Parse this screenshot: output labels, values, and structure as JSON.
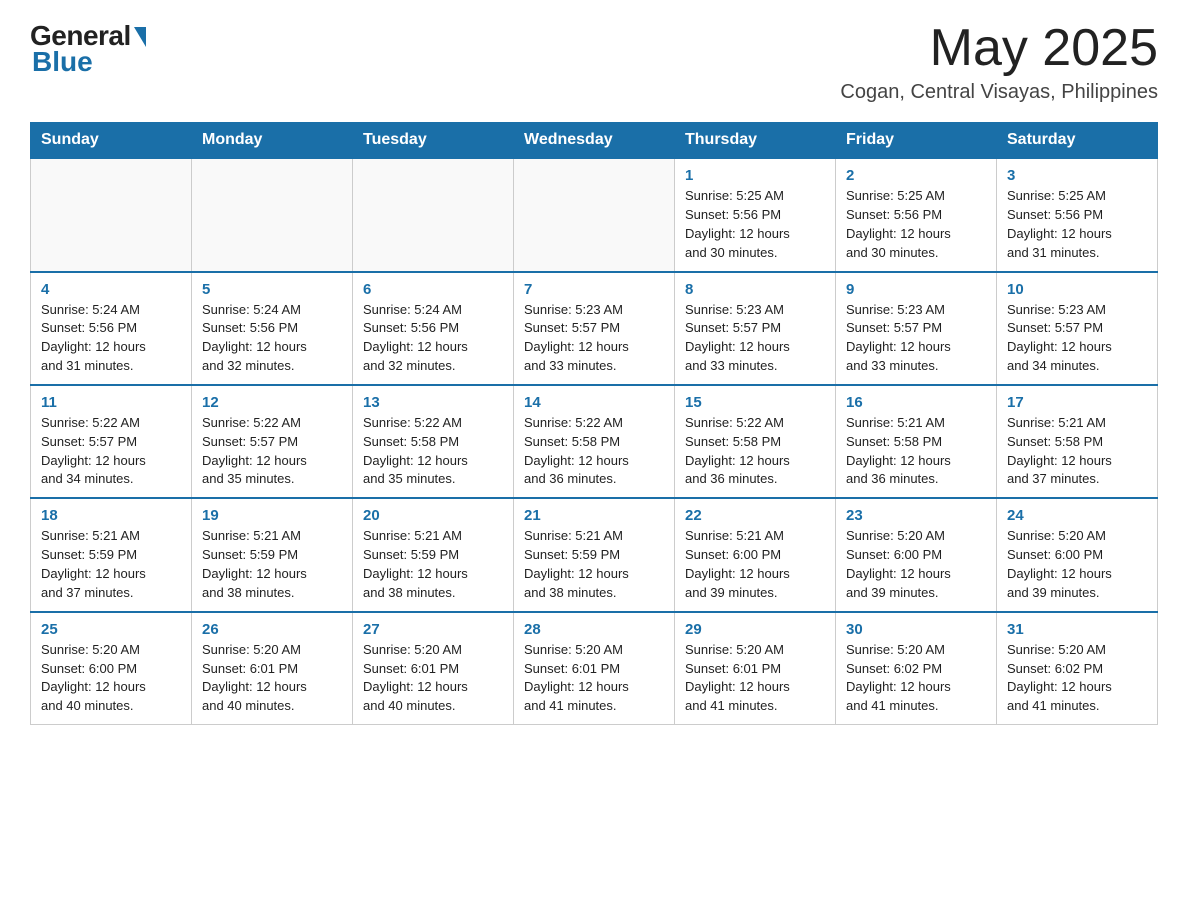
{
  "header": {
    "logo_general": "General",
    "logo_blue": "Blue",
    "month_year": "May 2025",
    "location": "Cogan, Central Visayas, Philippines"
  },
  "days_of_week": [
    "Sunday",
    "Monday",
    "Tuesday",
    "Wednesday",
    "Thursday",
    "Friday",
    "Saturday"
  ],
  "weeks": [
    [
      {
        "num": "",
        "info": ""
      },
      {
        "num": "",
        "info": ""
      },
      {
        "num": "",
        "info": ""
      },
      {
        "num": "",
        "info": ""
      },
      {
        "num": "1",
        "info": "Sunrise: 5:25 AM\nSunset: 5:56 PM\nDaylight: 12 hours\nand 30 minutes."
      },
      {
        "num": "2",
        "info": "Sunrise: 5:25 AM\nSunset: 5:56 PM\nDaylight: 12 hours\nand 30 minutes."
      },
      {
        "num": "3",
        "info": "Sunrise: 5:25 AM\nSunset: 5:56 PM\nDaylight: 12 hours\nand 31 minutes."
      }
    ],
    [
      {
        "num": "4",
        "info": "Sunrise: 5:24 AM\nSunset: 5:56 PM\nDaylight: 12 hours\nand 31 minutes."
      },
      {
        "num": "5",
        "info": "Sunrise: 5:24 AM\nSunset: 5:56 PM\nDaylight: 12 hours\nand 32 minutes."
      },
      {
        "num": "6",
        "info": "Sunrise: 5:24 AM\nSunset: 5:56 PM\nDaylight: 12 hours\nand 32 minutes."
      },
      {
        "num": "7",
        "info": "Sunrise: 5:23 AM\nSunset: 5:57 PM\nDaylight: 12 hours\nand 33 minutes."
      },
      {
        "num": "8",
        "info": "Sunrise: 5:23 AM\nSunset: 5:57 PM\nDaylight: 12 hours\nand 33 minutes."
      },
      {
        "num": "9",
        "info": "Sunrise: 5:23 AM\nSunset: 5:57 PM\nDaylight: 12 hours\nand 33 minutes."
      },
      {
        "num": "10",
        "info": "Sunrise: 5:23 AM\nSunset: 5:57 PM\nDaylight: 12 hours\nand 34 minutes."
      }
    ],
    [
      {
        "num": "11",
        "info": "Sunrise: 5:22 AM\nSunset: 5:57 PM\nDaylight: 12 hours\nand 34 minutes."
      },
      {
        "num": "12",
        "info": "Sunrise: 5:22 AM\nSunset: 5:57 PM\nDaylight: 12 hours\nand 35 minutes."
      },
      {
        "num": "13",
        "info": "Sunrise: 5:22 AM\nSunset: 5:58 PM\nDaylight: 12 hours\nand 35 minutes."
      },
      {
        "num": "14",
        "info": "Sunrise: 5:22 AM\nSunset: 5:58 PM\nDaylight: 12 hours\nand 36 minutes."
      },
      {
        "num": "15",
        "info": "Sunrise: 5:22 AM\nSunset: 5:58 PM\nDaylight: 12 hours\nand 36 minutes."
      },
      {
        "num": "16",
        "info": "Sunrise: 5:21 AM\nSunset: 5:58 PM\nDaylight: 12 hours\nand 36 minutes."
      },
      {
        "num": "17",
        "info": "Sunrise: 5:21 AM\nSunset: 5:58 PM\nDaylight: 12 hours\nand 37 minutes."
      }
    ],
    [
      {
        "num": "18",
        "info": "Sunrise: 5:21 AM\nSunset: 5:59 PM\nDaylight: 12 hours\nand 37 minutes."
      },
      {
        "num": "19",
        "info": "Sunrise: 5:21 AM\nSunset: 5:59 PM\nDaylight: 12 hours\nand 38 minutes."
      },
      {
        "num": "20",
        "info": "Sunrise: 5:21 AM\nSunset: 5:59 PM\nDaylight: 12 hours\nand 38 minutes."
      },
      {
        "num": "21",
        "info": "Sunrise: 5:21 AM\nSunset: 5:59 PM\nDaylight: 12 hours\nand 38 minutes."
      },
      {
        "num": "22",
        "info": "Sunrise: 5:21 AM\nSunset: 6:00 PM\nDaylight: 12 hours\nand 39 minutes."
      },
      {
        "num": "23",
        "info": "Sunrise: 5:20 AM\nSunset: 6:00 PM\nDaylight: 12 hours\nand 39 minutes."
      },
      {
        "num": "24",
        "info": "Sunrise: 5:20 AM\nSunset: 6:00 PM\nDaylight: 12 hours\nand 39 minutes."
      }
    ],
    [
      {
        "num": "25",
        "info": "Sunrise: 5:20 AM\nSunset: 6:00 PM\nDaylight: 12 hours\nand 40 minutes."
      },
      {
        "num": "26",
        "info": "Sunrise: 5:20 AM\nSunset: 6:01 PM\nDaylight: 12 hours\nand 40 minutes."
      },
      {
        "num": "27",
        "info": "Sunrise: 5:20 AM\nSunset: 6:01 PM\nDaylight: 12 hours\nand 40 minutes."
      },
      {
        "num": "28",
        "info": "Sunrise: 5:20 AM\nSunset: 6:01 PM\nDaylight: 12 hours\nand 41 minutes."
      },
      {
        "num": "29",
        "info": "Sunrise: 5:20 AM\nSunset: 6:01 PM\nDaylight: 12 hours\nand 41 minutes."
      },
      {
        "num": "30",
        "info": "Sunrise: 5:20 AM\nSunset: 6:02 PM\nDaylight: 12 hours\nand 41 minutes."
      },
      {
        "num": "31",
        "info": "Sunrise: 5:20 AM\nSunset: 6:02 PM\nDaylight: 12 hours\nand 41 minutes."
      }
    ]
  ]
}
